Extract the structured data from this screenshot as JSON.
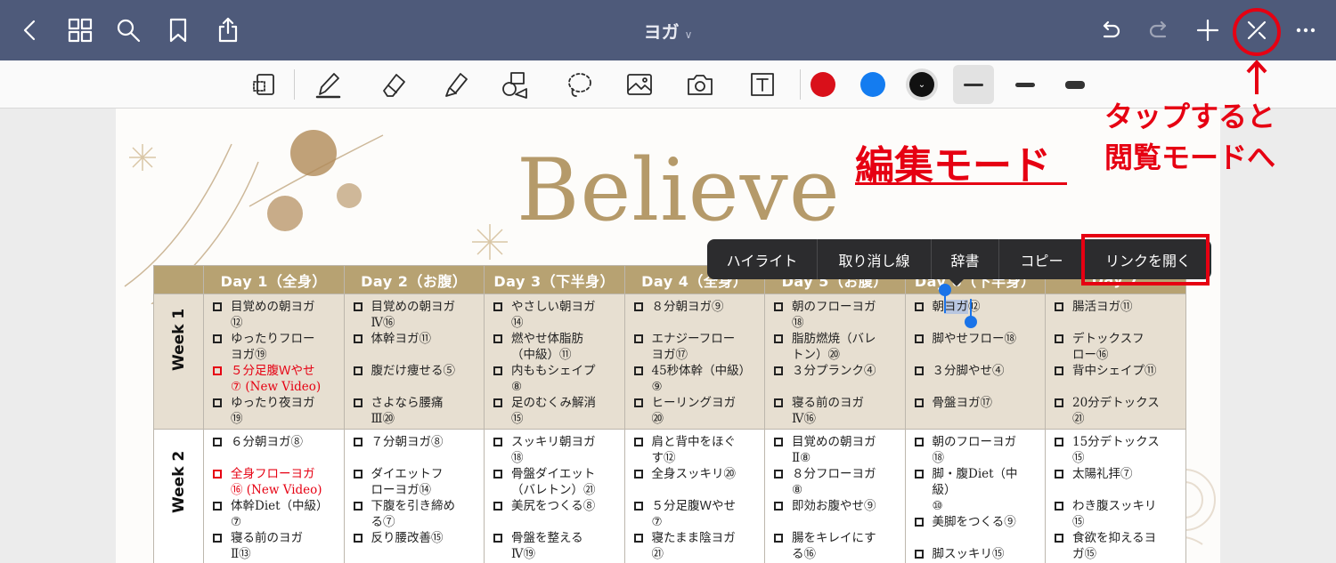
{
  "app": {
    "title": "ヨガ"
  },
  "toolbar_colors": {
    "red": "#d9101a",
    "blue": "#147cf0",
    "black": "#111111"
  },
  "page": {
    "heading": "Believe"
  },
  "annotations": {
    "edit_mode": "編集モード",
    "tap_hint_line1": "タップすると",
    "tap_hint_line2": "閲覧モードへ"
  },
  "context_menu": {
    "items": [
      "ハイライト",
      "取り消し線",
      "辞書",
      "コピー",
      "リンクを開く"
    ]
  },
  "schedule": {
    "headers": [
      "Day 1（全身）",
      "Day 2（お腹）",
      "Day 3（下半身）",
      "Day 4（全身）",
      "Day 5（お腹）",
      "Day 6（下半身）",
      "Day 7"
    ],
    "weeks": [
      {
        "label": "Week 1",
        "days": [
          [
            {
              "t": "目覚めの朝ヨガ\n⑫"
            },
            {
              "t": "ゆったりフロー\nヨガ⑲"
            },
            {
              "t": "５分足腹Ｗやせ\n⑦ (New Video)",
              "new": true
            },
            {
              "t": "ゆったり夜ヨガ\n⑲"
            }
          ],
          [
            {
              "t": "目覚めの朝ヨガ\nⅣ⑯"
            },
            {
              "t": "体幹ヨガ⑪"
            },
            {
              "t": "腹だけ痩せる⑤"
            },
            {
              "t": "さよなら腰痛\nⅢ⑳"
            }
          ],
          [
            {
              "t": "やさしい朝ヨガ\n⑭"
            },
            {
              "t": "燃やせ体脂肪\n（中級）⑪"
            },
            {
              "t": "内ももシェイプ\n⑧"
            },
            {
              "t": "足のむくみ解消\n⑮"
            }
          ],
          [
            {
              "t": "８分朝ヨガ⑨"
            },
            {
              "t": "エナジーフロー\nヨガ⑰"
            },
            {
              "t": "45秒体幹（中級）\n⑨"
            },
            {
              "t": "ヒーリングヨガ\n⑳"
            }
          ],
          [
            {
              "t": "朝のフローヨガ\n⑱"
            },
            {
              "t": "脂肪燃焼（バレ\nトン）⑳"
            },
            {
              "t": "３分プランク④"
            },
            {
              "t": "寝る前のヨガ\nⅣ⑯"
            }
          ],
          [
            {
              "t": "朝ヨガ⑫"
            },
            {
              "t": "脚やせフロー⑱"
            },
            {
              "t": "３分脚やせ④"
            },
            {
              "t": "骨盤ヨガ⑰"
            }
          ],
          [
            {
              "t": "腸活ヨガ⑪"
            },
            {
              "t": "デトックスフ\nロー⑯"
            },
            {
              "t": "背中シェイプ⑪"
            },
            {
              "t": "20分デトックス\n㉑"
            }
          ]
        ]
      },
      {
        "label": "Week 2",
        "days": [
          [
            {
              "t": "６分朝ヨガ⑧"
            },
            {
              "t": "全身フローヨガ\n⑯ (New Video)",
              "new": true
            },
            {
              "t": "体幹Diet（中級）\n⑦"
            },
            {
              "t": "寝る前のヨガ\nⅡ⑬"
            }
          ],
          [
            {
              "t": "７分朝ヨガ⑧"
            },
            {
              "t": "ダイエットフ\nローヨガ⑭"
            },
            {
              "t": "下腹を引き締め\nる⑦"
            },
            {
              "t": "反り腰改善⑮"
            }
          ],
          [
            {
              "t": "スッキリ朝ヨガ\n⑱"
            },
            {
              "t": "骨盤ダイエット\n（バレトン）㉑"
            },
            {
              "t": "美尻をつくる⑧"
            },
            {
              "t": "骨盤を整える\nⅣ⑲"
            }
          ],
          [
            {
              "t": "肩と背中をほぐ\nす⑫"
            },
            {
              "t": "全身スッキリ⑳"
            },
            {
              "t": "５分足腹Ｗやせ\n⑦"
            },
            {
              "t": "寝たまま陰ヨガ\n㉑"
            }
          ],
          [
            {
              "t": "目覚めの朝ヨガ\nⅡ⑧"
            },
            {
              "t": "８分フローヨガ\n⑧"
            },
            {
              "t": "即効お腹やせ⑨"
            },
            {
              "t": "腸をキレイにす\nる⑯"
            }
          ],
          [
            {
              "t": "朝のフローヨガ\n⑱"
            },
            {
              "t": "脚・腹Diet（中級）\n⑩"
            },
            {
              "t": "美脚をつくる⑨"
            },
            {
              "t": "脚スッキリ⑮"
            }
          ],
          [
            {
              "t": "15分デトックス\n⑮"
            },
            {
              "t": "太陽礼拝⑦"
            },
            {
              "t": "わき腹スッキリ\n⑮"
            },
            {
              "t": "食欲を抑えるヨ\nガ⑮"
            }
          ]
        ]
      }
    ]
  }
}
